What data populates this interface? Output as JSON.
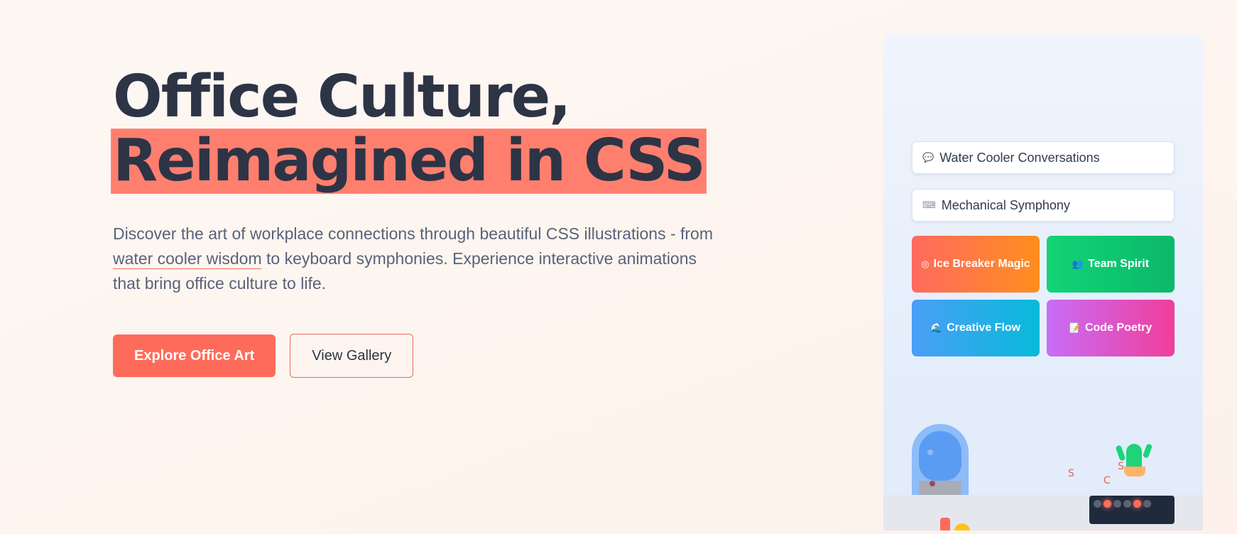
{
  "hero": {
    "title_line1": "Office Culture,",
    "title_line2": "Reimagined in CSS",
    "description_part1": "Discover the art of workplace connections through beautiful CSS illustrations - from ",
    "description_underlined": "water cooler wisdom",
    "description_part2": " to keyboard symphonies. Experience interactive animations that bring office culture to life.",
    "primary_button": "Explore Office Art",
    "secondary_button": "View Gallery"
  },
  "panel": {
    "pills": [
      {
        "icon": "speech-bubble-icon",
        "glyph": "💬",
        "label": "Water Cooler Conversations"
      },
      {
        "icon": "keyboard-icon",
        "glyph": "⌨",
        "label": "Mechanical Symphony"
      }
    ],
    "cards": [
      {
        "icon": "target-icon",
        "glyph": "◎",
        "label": "Ice Breaker Magic"
      },
      {
        "icon": "people-icon",
        "glyph": "👥",
        "label": "Team Spirit"
      },
      {
        "icon": "wave-icon",
        "glyph": "🌊",
        "label": "Creative Flow"
      },
      {
        "icon": "memo-icon",
        "glyph": "📝",
        "label": "Code Poetry"
      }
    ],
    "floating_letters": [
      "S",
      "C",
      "S"
    ]
  },
  "colors": {
    "accent": "#ff6b5a",
    "heading": "#2d3446",
    "body_text": "#5a6278",
    "highlight": "#ff7f6e"
  }
}
